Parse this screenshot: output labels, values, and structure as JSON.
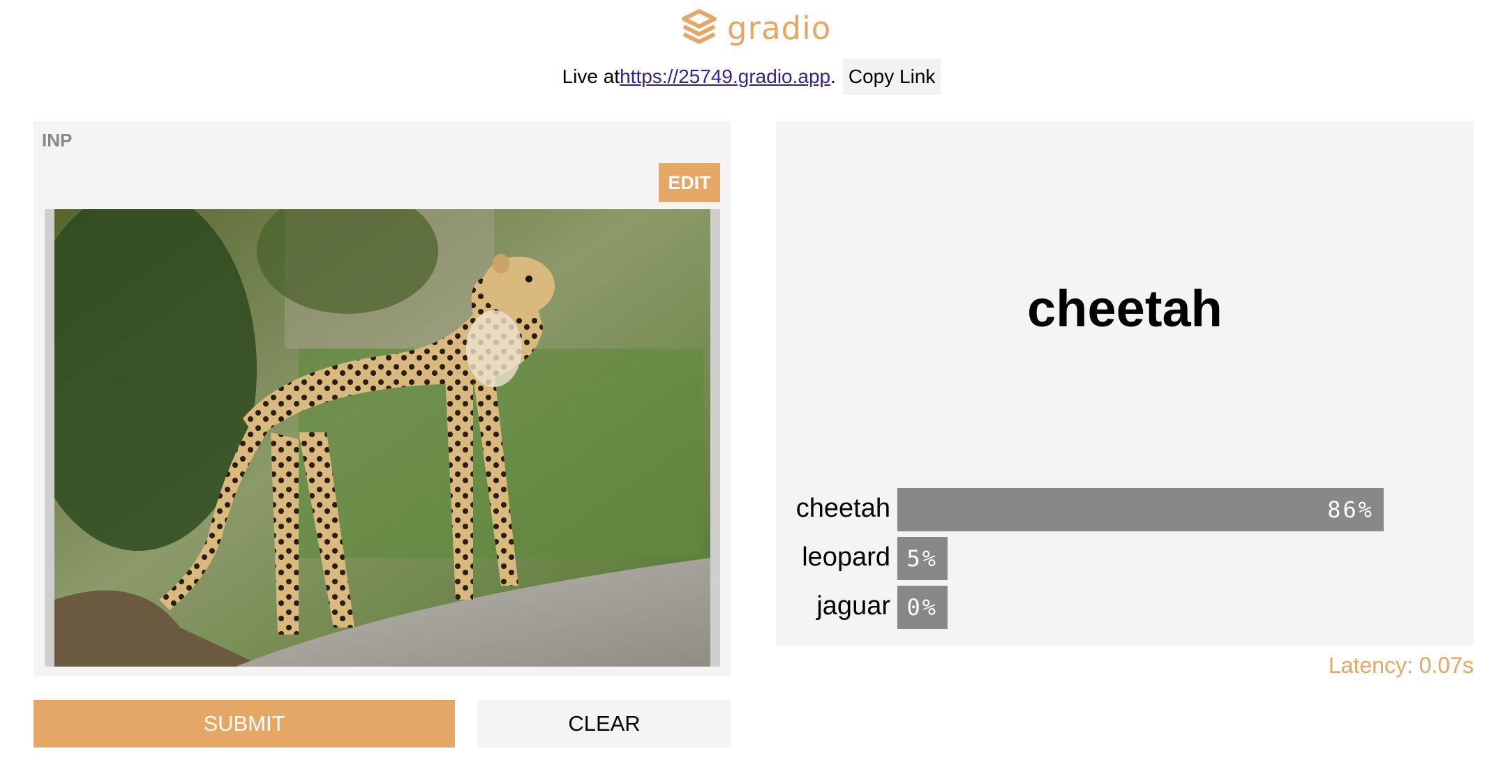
{
  "header": {
    "logo_text": "gradio",
    "live_prefix": "Live at ",
    "live_url": "https://25749.gradio.app",
    "live_suffix": ".",
    "copy_link_label": "Copy Link"
  },
  "input": {
    "label": "INP",
    "edit_label": "EDIT",
    "image_subject": "cheetah-photo"
  },
  "actions": {
    "submit_label": "SUBMIT",
    "clear_label": "CLEAR"
  },
  "output": {
    "predicted_label": "cheetah",
    "confidences": [
      {
        "label": "cheetah",
        "value": 0.86,
        "text": "86%"
      },
      {
        "label": "leopard",
        "value": 0.05,
        "text": "5%"
      },
      {
        "label": "jaguar",
        "value": 0.0,
        "text": "0%"
      }
    ]
  },
  "latency_text": "Latency: 0.07s",
  "colors": {
    "accent": "#e4a766",
    "panel_bg": "#f4f4f4",
    "bar": "#888888"
  }
}
